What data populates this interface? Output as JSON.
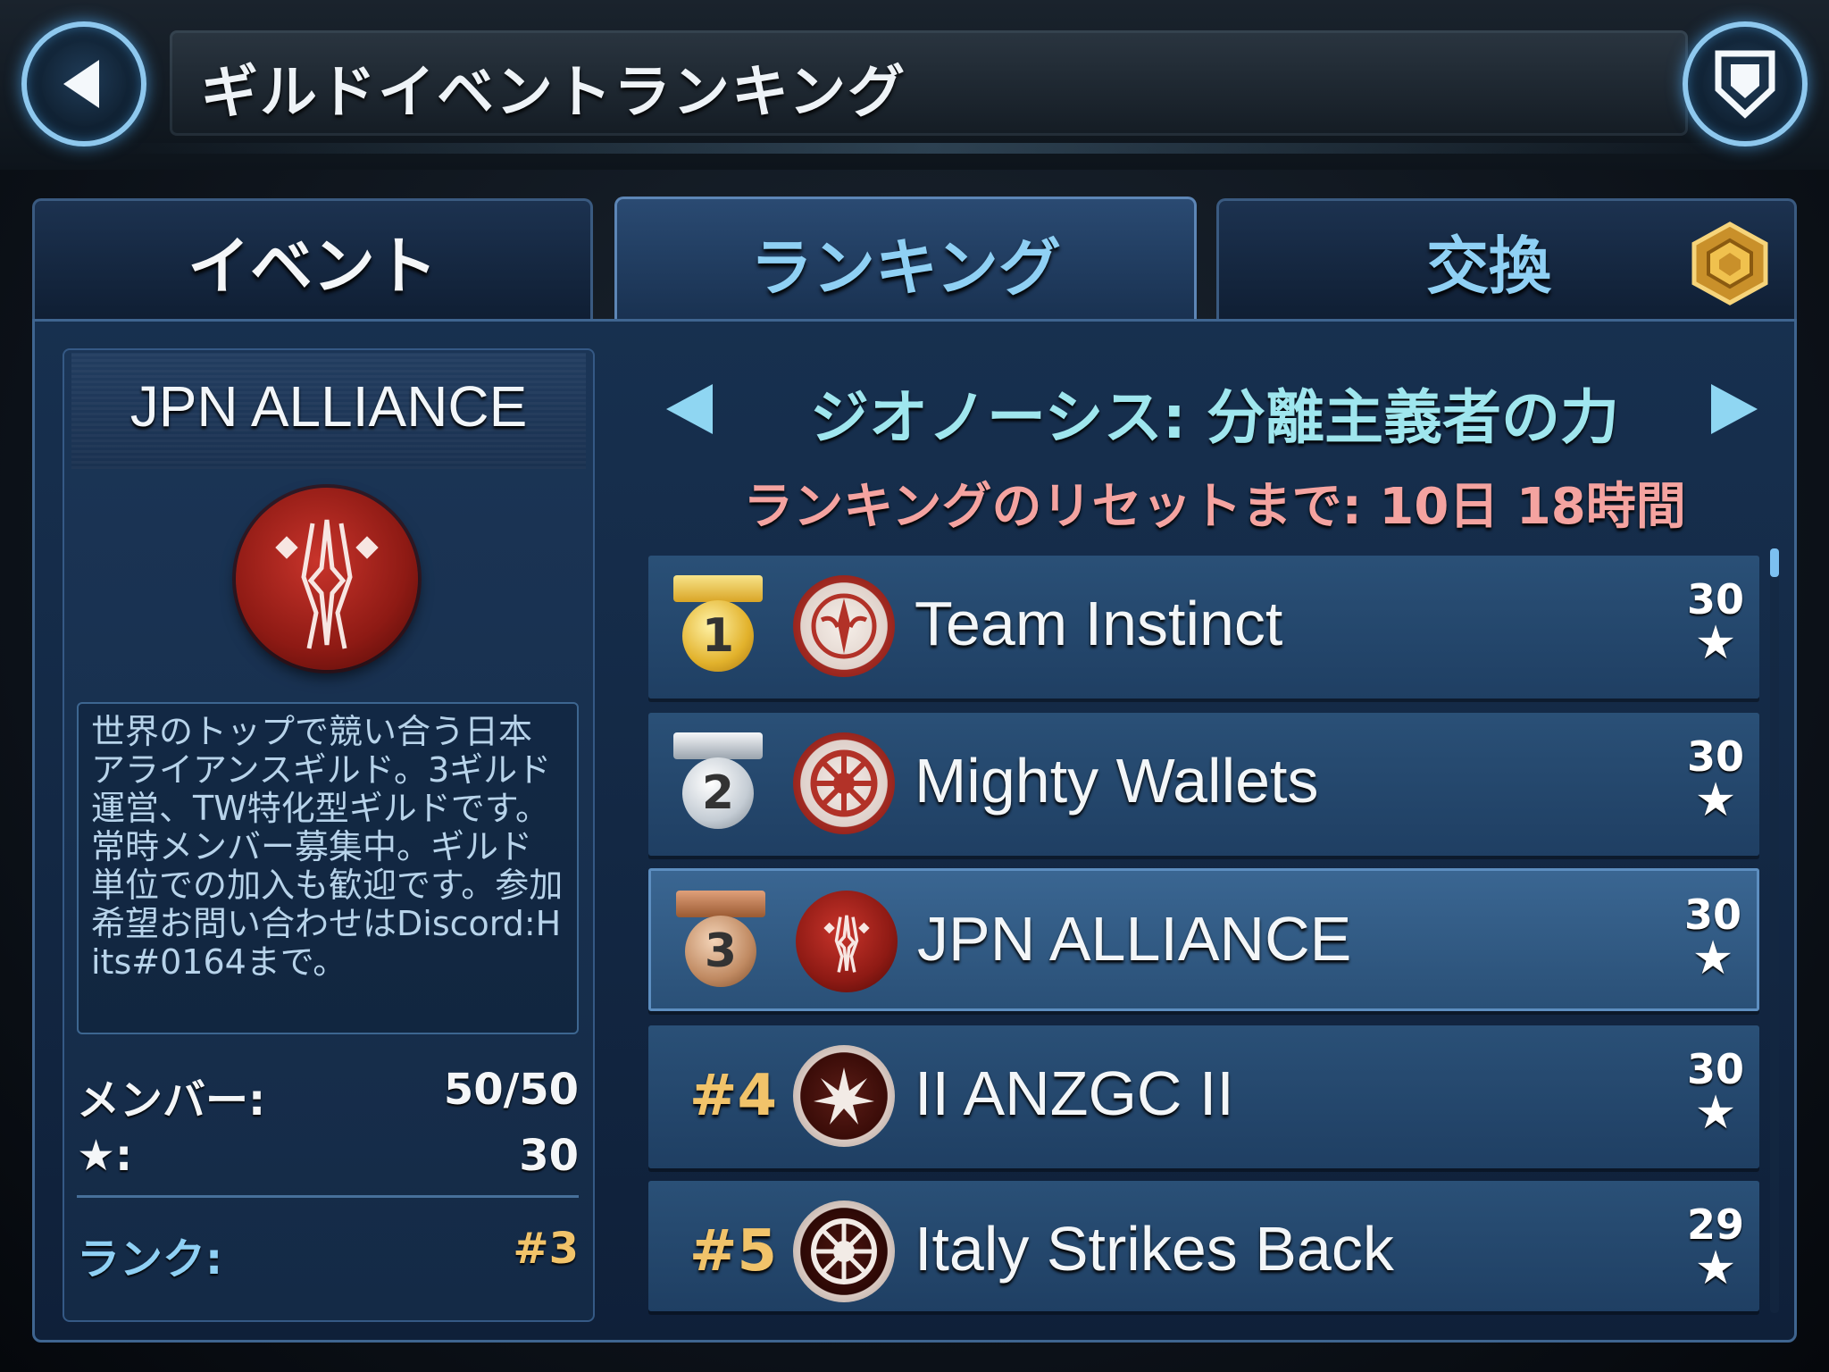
{
  "header": {
    "title": "ギルドイベントランキング",
    "back_icon": "back-arrow-icon",
    "guild_icon": "shield-icon"
  },
  "tabs": [
    {
      "label": "イベント",
      "active": false
    },
    {
      "label": "ランキング",
      "active": true
    },
    {
      "label": "交換",
      "active": false,
      "badge_icon": "currency-hex-icon"
    }
  ],
  "guild": {
    "name": "JPN ALLIANCE",
    "emblem_icon": "guild-emblem-icon",
    "description": "世界のトップで競い合う日本アライアンスギルド。3ギルド運営、TW特化型ギルドです。常時メンバー募集中。ギルド単位での加入も歓迎です。参加希望お問い合わせはDiscord:Hits#0164まで。",
    "members_label": "メンバー:",
    "members_value": "50/50",
    "stars_label": "★:",
    "stars_value": "30",
    "rank_label": "ランク:",
    "rank_value": "#3"
  },
  "event": {
    "title": "ジオノーシス: 分離主義者の力",
    "reset_text": "ランキングのリセットまで: 10日 18時間"
  },
  "colors": {
    "accent_cyan": "#9fe6ee",
    "reset_red": "#f4a3a0",
    "rank_gold": "#f1c36a",
    "panel_blue": "#17304f"
  },
  "ranking": [
    {
      "rank": "1",
      "medal": "gold",
      "name": "Team Instinct",
      "score": "30",
      "icon": "old-republic-icon",
      "highlight": false
    },
    {
      "rank": "2",
      "medal": "silver",
      "name": "Mighty Wallets",
      "score": "30",
      "icon": "imperial-icon",
      "highlight": false
    },
    {
      "rank": "3",
      "medal": "bronze",
      "name": "JPN ALLIANCE",
      "score": "30",
      "icon": "guild-emblem-icon",
      "highlight": true
    },
    {
      "rank": "#4",
      "medal": "",
      "name": "II ANZGC II",
      "score": "30",
      "icon": "burst-icon",
      "highlight": false
    },
    {
      "rank": "#5",
      "medal": "",
      "name": "Italy Strikes Back",
      "score": "29",
      "icon": "imperial-icon",
      "highlight": false
    }
  ],
  "star_glyph": "★"
}
